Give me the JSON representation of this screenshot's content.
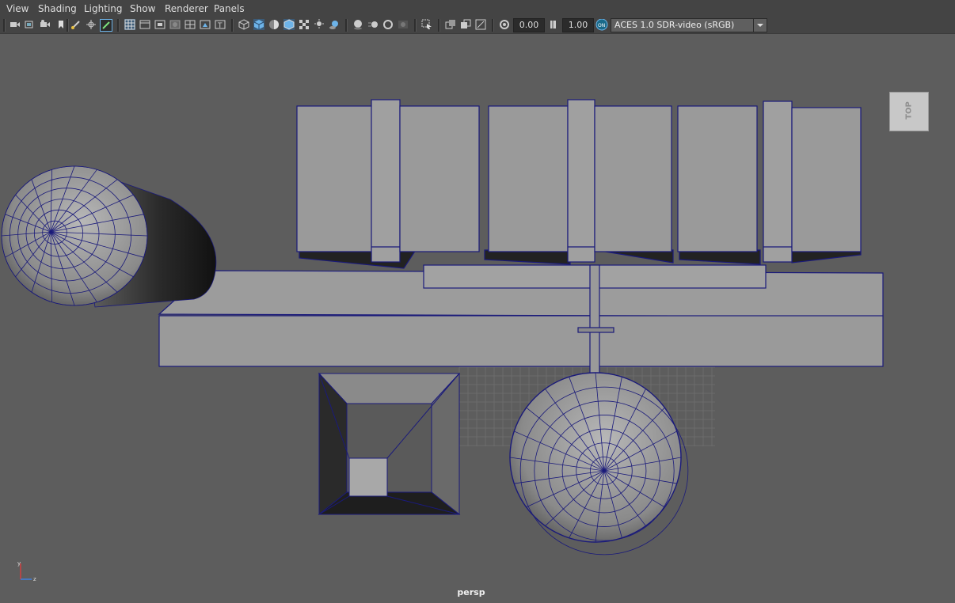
{
  "menubar": {
    "items": [
      {
        "label": "View"
      },
      {
        "label": "Shading"
      },
      {
        "label": "Lighting"
      },
      {
        "label": "Show"
      },
      {
        "label": "Renderer"
      },
      {
        "label": "Panels"
      }
    ]
  },
  "toolbar": {
    "exposure_value": "0.00",
    "gamma_value": "1.00",
    "colorspace_label": "ACES 1.0 SDR-video (sRGB)",
    "icons": [
      "camera-icon",
      "camera-attributes-icon",
      "film-gate-icon",
      "bookmark-icon",
      "grease-pencil-icon",
      "image-plane-icon",
      "grid-icon",
      "film-gate-toggle-icon",
      "resolution-gate-icon",
      "gate-mask-icon",
      "field-chart-icon",
      "safe-action-icon",
      "safe-title-icon",
      "wireframe-icon",
      "smooth-shade-icon",
      "default-material-icon",
      "wireframe-on-shaded-icon",
      "xray-icon",
      "textured-icon",
      "use-lights-icon",
      "shadows-icon",
      "screen-space-ao-icon",
      "motion-blur-icon",
      "anti-alias-icon",
      "depth-of-field-icon",
      "isolate-select-icon",
      "xray-joints-icon",
      "xray-active-icon",
      "backface-culling-icon",
      "exposure-icon",
      "gamma-icon",
      "color-management-icon"
    ],
    "accent": "#6db3e8"
  },
  "viewport": {
    "camera_label": "persp",
    "viewcube_label": "TOP",
    "background": "#5d5d5d",
    "wireframe_color": "#1a1a7a"
  },
  "axis": {
    "y": "y",
    "z": "z"
  }
}
